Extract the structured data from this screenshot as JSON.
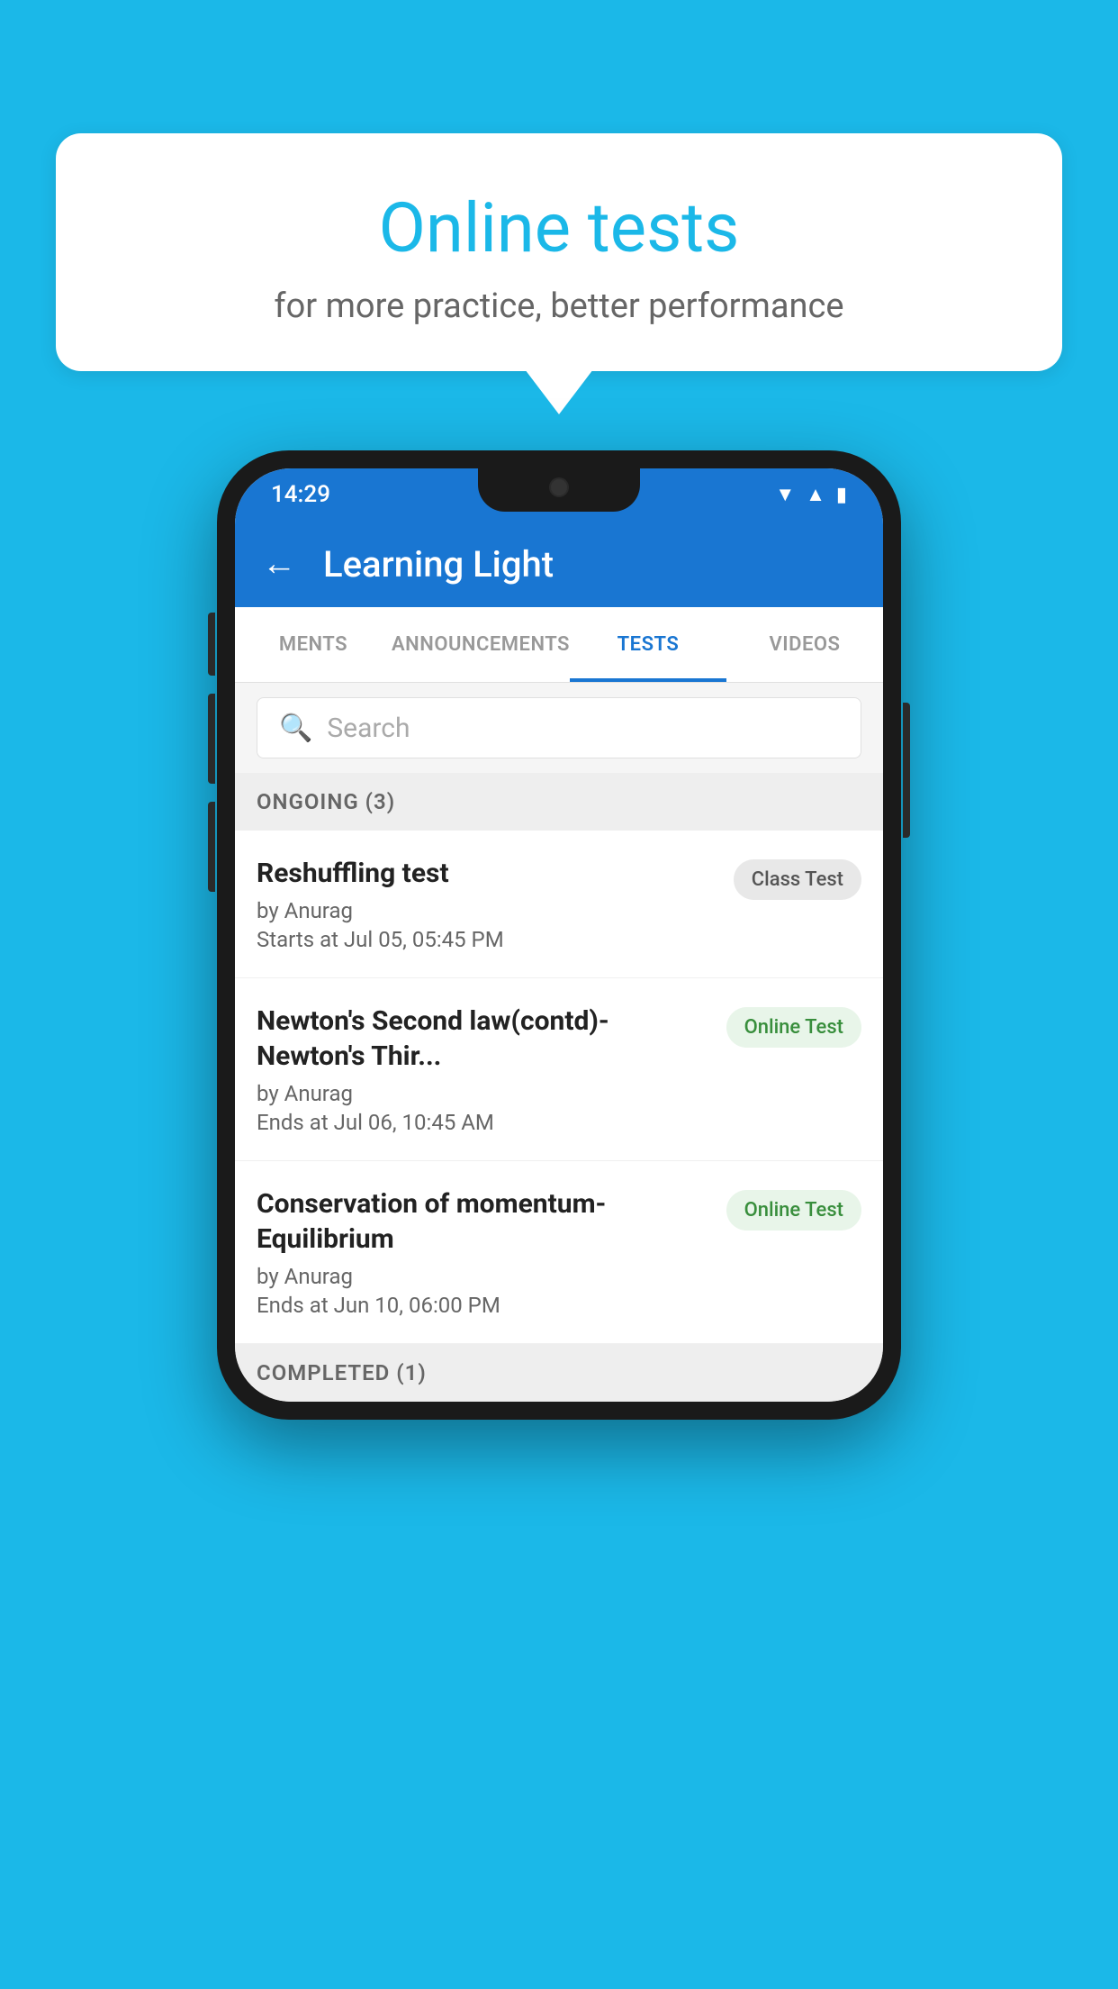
{
  "background": {
    "color": "#1BB8E8"
  },
  "speech_bubble": {
    "title": "Online tests",
    "subtitle": "for more practice, better performance"
  },
  "phone": {
    "status_bar": {
      "time": "14:29",
      "icons": [
        "wifi",
        "signal",
        "battery"
      ]
    },
    "top_bar": {
      "back_label": "←",
      "title": "Learning Light"
    },
    "tabs": [
      {
        "label": "MENTS",
        "active": false
      },
      {
        "label": "ANNOUNCEMENTS",
        "active": false
      },
      {
        "label": "TESTS",
        "active": true
      },
      {
        "label": "VIDEOS",
        "active": false
      }
    ],
    "search": {
      "placeholder": "Search"
    },
    "ongoing_section": {
      "label": "ONGOING (3)"
    },
    "test_items": [
      {
        "title": "Reshuffling test",
        "by": "by Anurag",
        "date": "Starts at  Jul 05, 05:45 PM",
        "badge": "Class Test",
        "badge_type": "class"
      },
      {
        "title": "Newton's Second law(contd)-Newton's Thir...",
        "by": "by Anurag",
        "date": "Ends at  Jul 06, 10:45 AM",
        "badge": "Online Test",
        "badge_type": "online"
      },
      {
        "title": "Conservation of momentum-Equilibrium",
        "by": "by Anurag",
        "date": "Ends at  Jun 10, 06:00 PM",
        "badge": "Online Test",
        "badge_type": "online"
      }
    ],
    "completed_section": {
      "label": "COMPLETED (1)"
    }
  }
}
